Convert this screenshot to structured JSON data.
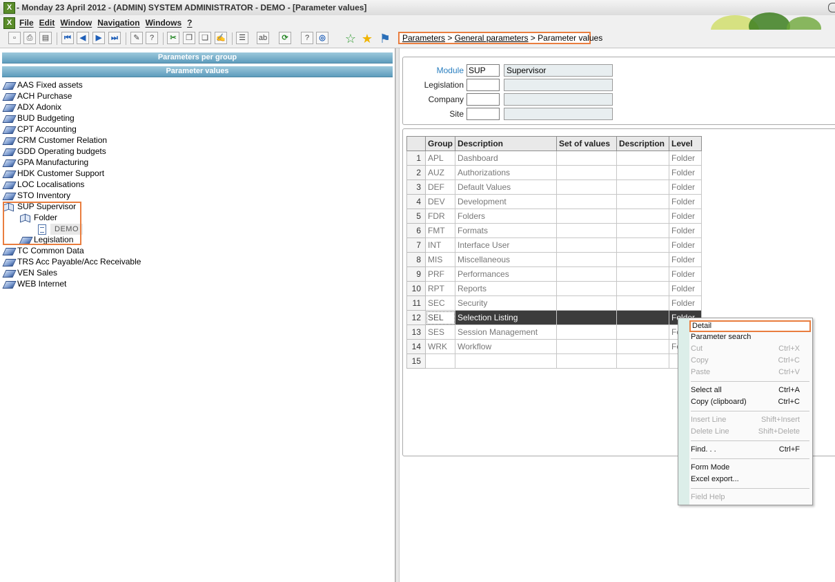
{
  "window": {
    "title": "- Monday 23 April 2012 - (ADMIN) SYSTEM ADMINISTRATOR - DEMO - [Parameter values]"
  },
  "menu": {
    "items": [
      "File",
      "Edit",
      "Window",
      "Navigation",
      "Windows",
      "?"
    ]
  },
  "toolbar": {
    "icons": [
      "new-icon",
      "print-icon",
      "print-preview-icon",
      "first-record-icon",
      "previous-record-icon",
      "next-record-icon",
      "last-record-icon",
      "attachment-icon",
      "help-icon",
      "cut-icon",
      "copy-icon",
      "paste-icon",
      "edit-icon",
      "list-icon",
      "text-icon",
      "refresh-icon",
      "info-icon",
      "web-icon"
    ],
    "favorites": [
      "add-favorite-icon",
      "favorite-star-icon",
      "signpost-icon"
    ]
  },
  "breadcrumb": {
    "level1": "Parameters",
    "level2": "General parameters",
    "current": "Parameter values",
    "separator": ">"
  },
  "left_panel": {
    "ribbon1": "Parameters per group",
    "ribbon2": "Parameter values",
    "tree": [
      {
        "label": "AAS Fixed assets"
      },
      {
        "label": "ACH Purchase"
      },
      {
        "label": "ADX Adonix"
      },
      {
        "label": "BUD Budgeting"
      },
      {
        "label": "CPT Accounting"
      },
      {
        "label": "CRM Customer Relation"
      },
      {
        "label": "GDD Operating budgets"
      },
      {
        "label": "GPA Manufacturing"
      },
      {
        "label": "HDK Customer Support"
      },
      {
        "label": "LOC Localisations"
      },
      {
        "label": "STO Inventory"
      },
      {
        "label": "SUP Supervisor"
      },
      {
        "label": "Folder"
      },
      {
        "label": "DEMO"
      },
      {
        "label": "Legislation"
      },
      {
        "label": "TC Common Data"
      },
      {
        "label": "TRS Acc Payable/Acc Receivable"
      },
      {
        "label": "VEN Sales"
      },
      {
        "label": "WEB Internet"
      }
    ]
  },
  "criteria": {
    "module_label": "Module",
    "module_value": "SUP",
    "module_desc": "Supervisor",
    "legislation_label": "Legislation",
    "legislation_value": "",
    "legislation_desc": "",
    "company_label": "Company",
    "company_value": "",
    "company_desc": "",
    "site_label": "Site",
    "site_value": "",
    "site_desc": ""
  },
  "grid": {
    "headers": [
      "Group",
      "Description",
      "Set of values",
      "Description",
      "Level"
    ],
    "rows": [
      {
        "n": "1",
        "group": "APL",
        "desc": "Dashboard",
        "set": "",
        "desc2": "",
        "level": "Folder"
      },
      {
        "n": "2",
        "group": "AUZ",
        "desc": "Authorizations",
        "set": "",
        "desc2": "",
        "level": "Folder"
      },
      {
        "n": "3",
        "group": "DEF",
        "desc": "Default Values",
        "set": "",
        "desc2": "",
        "level": "Folder"
      },
      {
        "n": "4",
        "group": "DEV",
        "desc": "Development",
        "set": "",
        "desc2": "",
        "level": "Folder"
      },
      {
        "n": "5",
        "group": "FDR",
        "desc": "Folders",
        "set": "",
        "desc2": "",
        "level": "Folder"
      },
      {
        "n": "6",
        "group": "FMT",
        "desc": "Formats",
        "set": "",
        "desc2": "",
        "level": "Folder"
      },
      {
        "n": "7",
        "group": "INT",
        "desc": "Interface User",
        "set": "",
        "desc2": "",
        "level": "Folder"
      },
      {
        "n": "8",
        "group": "MIS",
        "desc": "Miscellaneous",
        "set": "",
        "desc2": "",
        "level": "Folder"
      },
      {
        "n": "9",
        "group": "PRF",
        "desc": "Performances",
        "set": "",
        "desc2": "",
        "level": "Folder"
      },
      {
        "n": "10",
        "group": "RPT",
        "desc": "Reports",
        "set": "",
        "desc2": "",
        "level": "Folder"
      },
      {
        "n": "11",
        "group": "SEC",
        "desc": "Security",
        "set": "",
        "desc2": "",
        "level": "Folder"
      },
      {
        "n": "12",
        "group": "SEL",
        "desc": "Selection Listing",
        "set": "",
        "desc2": "",
        "level": "Folder"
      },
      {
        "n": "13",
        "group": "SES",
        "desc": "Session Management",
        "set": "",
        "desc2": "",
        "level": "Fo"
      },
      {
        "n": "14",
        "group": "WRK",
        "desc": "Workflow",
        "set": "",
        "desc2": "",
        "level": "Fo"
      },
      {
        "n": "15",
        "group": "",
        "desc": "",
        "set": "",
        "desc2": "",
        "level": ""
      }
    ],
    "selected_row": "12"
  },
  "context_menu": {
    "detail": "Detail",
    "parameter_search": "Parameter search",
    "cut": "Cut",
    "cut_sc": "Ctrl+X",
    "copy": "Copy",
    "copy_sc": "Ctrl+C",
    "paste": "Paste",
    "paste_sc": "Ctrl+V",
    "select_all": "Select all",
    "select_all_sc": "Ctrl+A",
    "copy_clip": "Copy (clipboard)",
    "copy_clip_sc": "Ctrl+C",
    "insert_line": "Insert Line",
    "insert_line_sc": "Shift+Insert",
    "delete_line": "Delete Line",
    "delete_line_sc": "Shift+Delete",
    "find": "Find. . .",
    "find_sc": "Ctrl+F",
    "form_mode": "Form Mode",
    "excel_export": "Excel export...",
    "field_help": "Field Help"
  },
  "colors": {
    "highlight_border": "#e97d3e",
    "ribbon": "#6fa8c6",
    "selected_row": "#3c3c3c",
    "module_label": "#2a7fc0"
  }
}
